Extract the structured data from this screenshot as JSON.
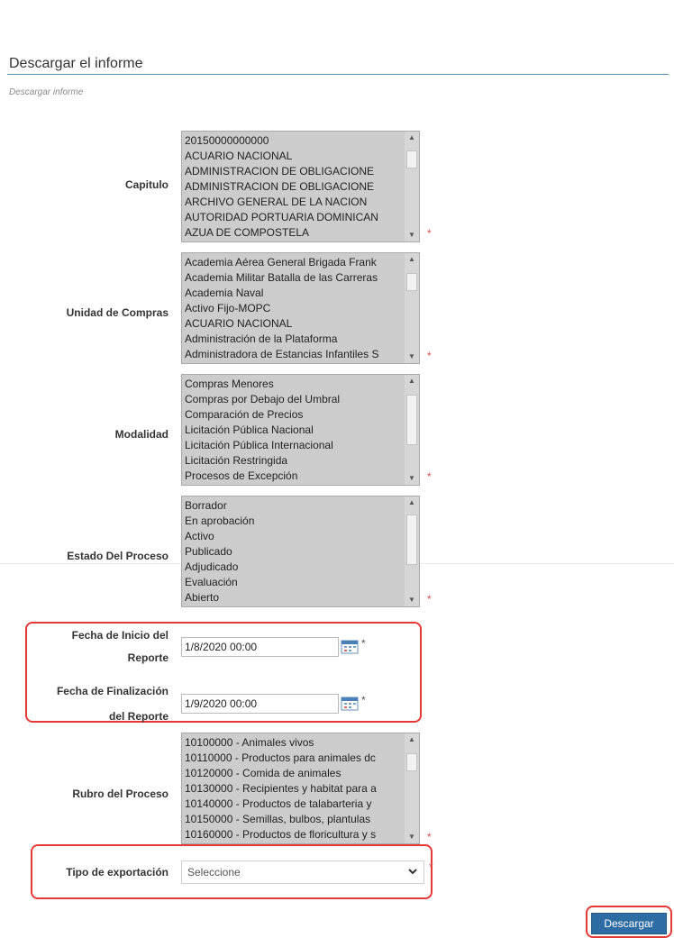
{
  "header": {
    "title": "Descargar el informe",
    "subtitle": "Descargar informe"
  },
  "form": {
    "capitulo": {
      "label": "Capitulo",
      "options": [
        "20150000000000",
        "ACUARIO NACIONAL",
        "ADMINISTRACION DE OBLIGACIONE",
        "ADMINISTRACION DE OBLIGACIONE",
        "ARCHIVO GENERAL DE LA NACION",
        "AUTORIDAD PORTUARIA DOMINICAN",
        "AZUA DE COMPOSTELA"
      ],
      "required": "*"
    },
    "unidad_compras": {
      "label": "Unidad de Compras",
      "options": [
        "Academia Aérea General Brigada Frank",
        "Academia Militar Batalla de las Carreras",
        "Academia Naval",
        "Activo Fijo-MOPC",
        "ACUARIO NACIONAL",
        "Administración de la Plataforma",
        "Administradora de Estancias Infantiles S"
      ],
      "required": "*"
    },
    "modalidad": {
      "label": "Modalidad",
      "options": [
        "Compras Menores",
        "Compras por Debajo del Umbral",
        "Comparación de Precios",
        "Licitación Pública Nacional",
        "Licitación Pública Internacional",
        "Licitación Restringida",
        "Procesos de Excepción"
      ],
      "required": "*"
    },
    "estado_proceso": {
      "label": "Estado Del Proceso",
      "options": [
        "Borrador",
        "En aprobación",
        "Activo",
        "Publicado",
        "Adjudicado",
        "Evaluación",
        "Abierto"
      ],
      "required": "*"
    },
    "fecha_inicio": {
      "label_line1": "Fecha de Inicio del",
      "label_line2": "Reporte",
      "value": "1/8/2020 00:00",
      "required": "*"
    },
    "fecha_fin": {
      "label_line1": "Fecha de Finalización",
      "label_line2": "del Reporte",
      "value": "1/9/2020 00:00",
      "required": "*"
    },
    "rubro_proceso": {
      "label": "Rubro del Proceso",
      "options": [
        "10100000 - Animales vivos",
        "10110000 - Productos para animales dc",
        "10120000 - Comida de animales",
        "10130000 - Recipientes y habitat para a",
        "10140000 - Productos de talabarteria y",
        "10150000 - Semillas, bulbos, plantulas",
        "10160000 - Productos de floricultura y s"
      ],
      "required": "*"
    },
    "tipo_exportacion": {
      "label": "Tipo de exportación",
      "selected": "Seleccione",
      "required": "*"
    }
  },
  "actions": {
    "download_label": "Descargar"
  },
  "colors": {
    "accent": "#2e6da4",
    "highlight": "#e53935",
    "required": "#d9534f",
    "listbox_bg": "#cccccc"
  }
}
